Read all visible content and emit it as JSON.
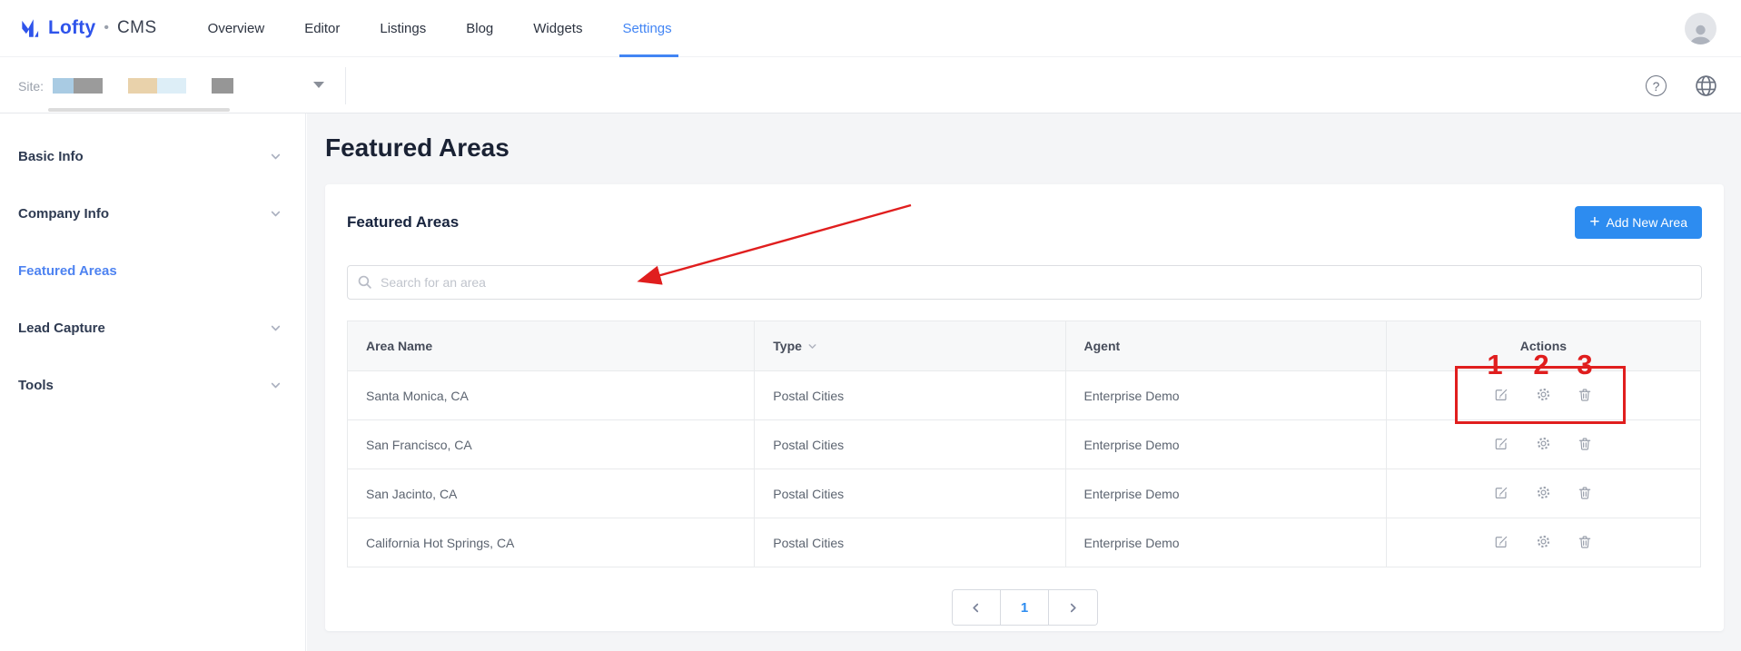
{
  "brand": {
    "name": "Lofty",
    "dot": "•",
    "product": "CMS"
  },
  "nav": {
    "items": [
      {
        "label": "Overview"
      },
      {
        "label": "Editor"
      },
      {
        "label": "Listings"
      },
      {
        "label": "Blog"
      },
      {
        "label": "Widgets"
      },
      {
        "label": "Settings",
        "active": true
      }
    ]
  },
  "site_bar": {
    "label": "Site:"
  },
  "icons": {
    "brand_mark": "lofty-logo",
    "help": "question-circle",
    "language": "globe",
    "avatar": "user-silhouette",
    "search": "magnifier",
    "type_sort": "caret-down",
    "row_edit": "edit-square",
    "row_settings": "gear",
    "row_delete": "trash",
    "prev": "chevron-left",
    "next": "chevron-right",
    "add": "plus"
  },
  "sidebar": {
    "items": [
      {
        "label": "Basic Info",
        "expandable": true
      },
      {
        "label": "Company Info",
        "expandable": true
      },
      {
        "label": "Featured Areas",
        "expandable": false,
        "active": true
      },
      {
        "label": "Lead Capture",
        "expandable": true
      },
      {
        "label": "Tools",
        "expandable": true
      }
    ]
  },
  "page": {
    "title": "Featured Areas"
  },
  "panel": {
    "title": "Featured Areas",
    "add_button_label": "Add New Area",
    "search_placeholder": "Search for an area"
  },
  "table": {
    "columns": [
      "Area Name",
      "Type",
      "Agent",
      "Actions"
    ],
    "rows": [
      {
        "area": "Santa Monica, CA",
        "type": "Postal Cities",
        "agent": "Enterprise Demo"
      },
      {
        "area": "San Francisco, CA",
        "type": "Postal Cities",
        "agent": "Enterprise Demo"
      },
      {
        "area": "San Jacinto, CA",
        "type": "Postal Cities",
        "agent": "Enterprise Demo"
      },
      {
        "area": "California Hot Springs, CA",
        "type": "Postal Cities",
        "agent": "Enterprise Demo"
      }
    ]
  },
  "pagination": {
    "current_page": "1"
  },
  "annotations": {
    "labels": [
      "1",
      "2",
      "3"
    ],
    "color": "#e01e1e",
    "target": "first-row-action-icons"
  },
  "colors": {
    "accent_blue": "#2d8cf0",
    "brand_blue": "#2f54eb",
    "active_link": "#4285f4",
    "sidebar_active": "#4e83f1",
    "annotation_red": "#e01e1e",
    "page_bg": "#f4f5f7",
    "border": "#e8eaec"
  }
}
